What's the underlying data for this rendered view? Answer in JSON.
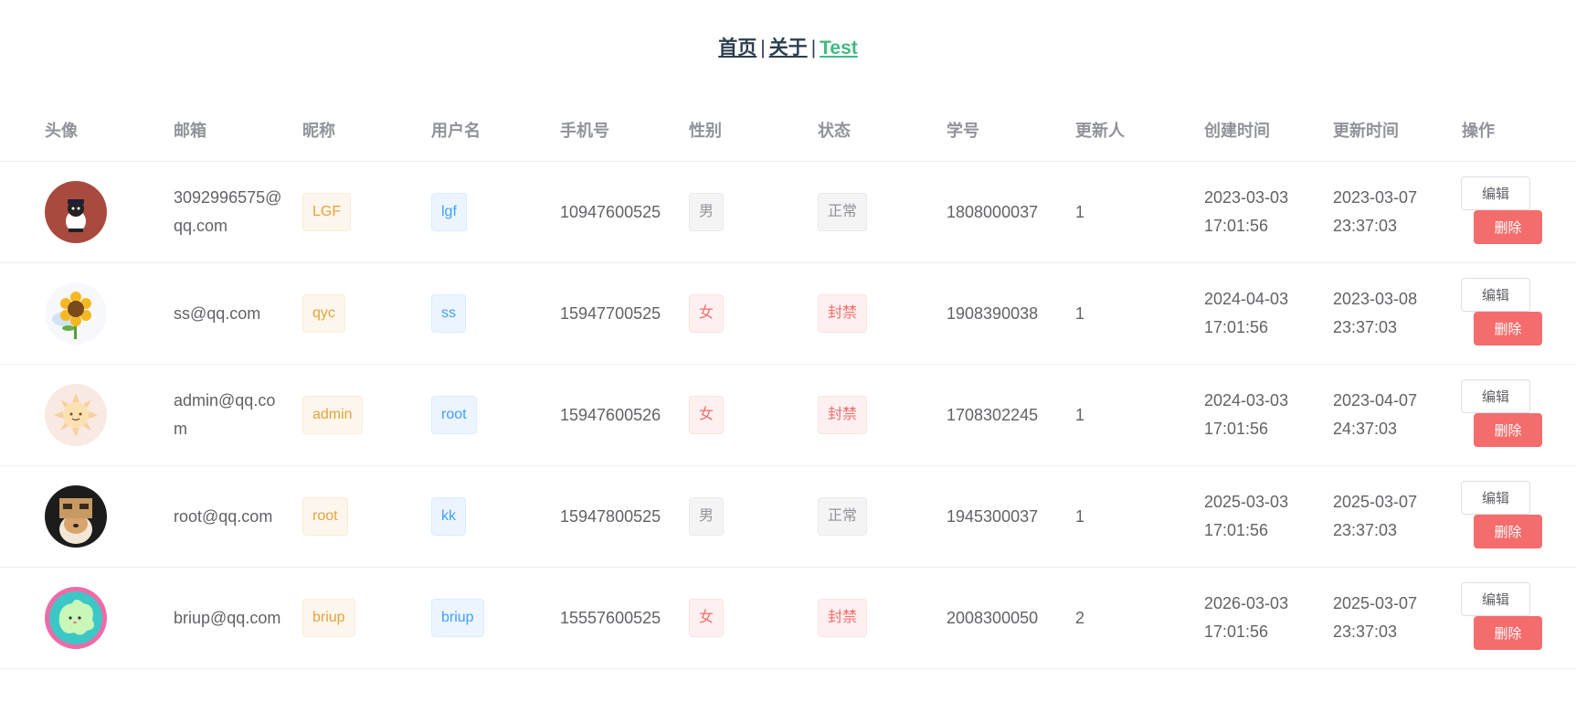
{
  "nav": {
    "home": "首页",
    "about": "关于",
    "test": "Test",
    "sep": "|"
  },
  "columns": [
    "头像",
    "邮箱",
    "昵称",
    "用户名",
    "手机号",
    "性别",
    "状态",
    "学号",
    "更新人",
    "创建时间",
    "更新时间",
    "操作"
  ],
  "buttons": {
    "edit": "编辑",
    "delete": "删除"
  },
  "rows": [
    {
      "email": "3092996575@qq.com",
      "nickname": "LGF",
      "username": "lgf",
      "phone": "10947600525",
      "gender": "男",
      "status": "正常",
      "student_id": "1808000037",
      "updater": "1",
      "created": "2023-03-03 17:01:56",
      "updated": "2023-03-07 23:37:03",
      "avatar_icon": "cat-avatar-icon",
      "gender_color": "info",
      "status_color": "info"
    },
    {
      "email": "ss@qq.com",
      "nickname": "qyc",
      "username": "ss",
      "phone": "15947700525",
      "gender": "女",
      "status": "封禁",
      "student_id": "1908390038",
      "updater": "1",
      "created": "2024-04-03 17:01:56",
      "updated": "2023-03-08 23:37:03",
      "avatar_icon": "sunflower-avatar-icon",
      "gender_color": "danger",
      "status_color": "danger"
    },
    {
      "email": "admin@qq.com",
      "nickname": "admin",
      "username": "root",
      "phone": "15947600526",
      "gender": "女",
      "status": "封禁",
      "student_id": "1708302245",
      "updater": "1",
      "created": "2024-03-03 17:01:56",
      "updated": "2023-04-07 24:37:03",
      "avatar_icon": "sun-avatar-icon",
      "gender_color": "danger",
      "status_color": "danger"
    },
    {
      "email": "root@qq.com",
      "nickname": "root",
      "username": "kk",
      "phone": "15947800525",
      "gender": "男",
      "status": "正常",
      "student_id": "1945300037",
      "updater": "1",
      "created": "2025-03-03 17:01:56",
      "updated": "2025-03-07 23:37:03",
      "avatar_icon": "dog-avatar-icon",
      "gender_color": "info",
      "status_color": "info"
    },
    {
      "email": "briup@qq.com",
      "nickname": "briup",
      "username": "briup",
      "phone": "15557600525",
      "gender": "女",
      "status": "封禁",
      "student_id": "2008300050",
      "updater": "2",
      "created": "2026-03-03 17:01:56",
      "updated": "2025-03-07 23:37:03",
      "avatar_icon": "ghost-avatar-icon",
      "gender_color": "danger",
      "status_color": "danger"
    }
  ],
  "colors": {
    "link": "#2c3e50",
    "active_link": "#42b983",
    "danger": "#f56c6c"
  }
}
